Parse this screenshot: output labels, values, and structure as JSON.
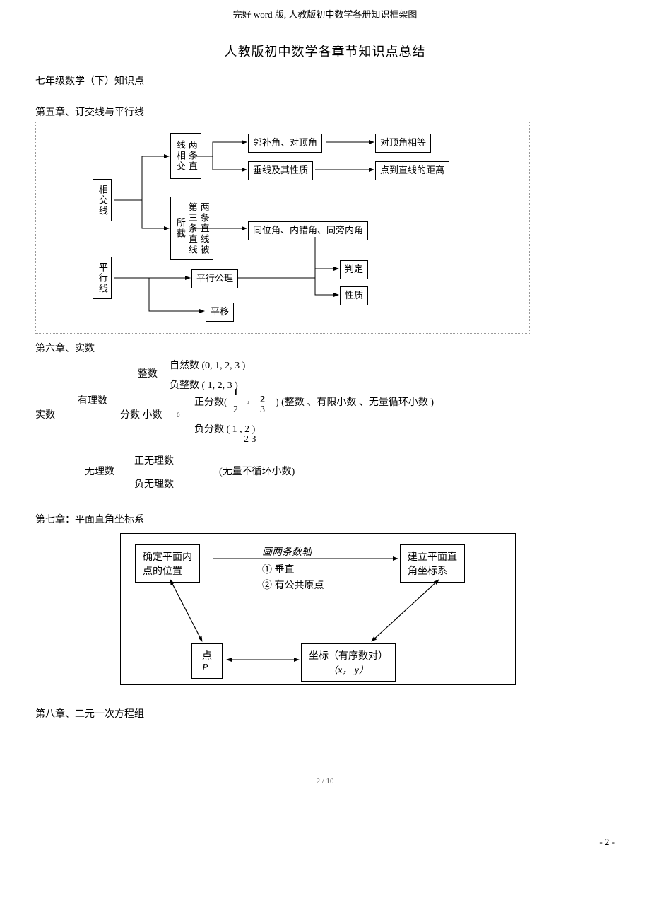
{
  "header": "完好 word 版, 人教版初中数学各册知识框架图",
  "title": "人教版初中数学各章节知识点总结",
  "grade_subtitle": "七年级数学（下）知识点",
  "chapter5": {
    "heading": "第五章、订交线与平行线",
    "nodes": {
      "root1": "相交线",
      "root2": "平行线",
      "a1": "两条直线相交",
      "a2": "两条直线被第三条直线所截",
      "b1": "邻补角、对顶角",
      "b2": "垂线及其性质",
      "c1": "对顶角相等",
      "c2": "点到直线的距离",
      "d1": "同位角、内错角、同旁内角",
      "e1": "平行公理",
      "e2": "平移",
      "f1": "判定",
      "f2": "性质"
    }
  },
  "chapter6": {
    "heading": "第六章、实数",
    "labels": {
      "shishu": "实数",
      "youli": "有理数",
      "wuli": "无理数",
      "zhengshu": "整数",
      "fenshu": "分数 小数",
      "ziranshu": "自然数 (0, 1,  2,  3   )",
      "fuzhengshu": "负整数 ( 1,    2,    3  )",
      "zhengfenshu": "正分数(",
      "zhengfenshu_frac1_top": "1",
      "zhengfenshu_frac1_bot": "2",
      "zhengfenshu_mid": " ,  ",
      "zhengfenshu_frac2_top": "2",
      "zhengfenshu_frac2_bot": "3",
      "zhengfenshu_close": ") (整数 、有限小数 、无量循环小数 )",
      "fufenshu": "负分数 (  1 ,   2     )",
      "fufenshu_bot": "2       3",
      "zhengwuli": "正无理数",
      "fuwuli": "负无理数",
      "wuxun": "(无量不循环小数)",
      "zero_sub": "0"
    }
  },
  "chapter7": {
    "heading": "第七章：平面直角坐标系",
    "nodes": {
      "left": "确定平面内\n点的位置",
      "mid_top": "画两条数轴",
      "mid1": "① 垂直",
      "mid2": "② 有公共原点",
      "right": "建立平面直\n角坐标系",
      "bl_top": "点",
      "bl_bot": "P",
      "br_top": "坐标（有序数对）",
      "br_bot": "（x， y）"
    }
  },
  "chapter8": {
    "heading": "第八章、二元一次方程组"
  },
  "page_marker": "- 2 -",
  "page_counter": "2 / 10"
}
